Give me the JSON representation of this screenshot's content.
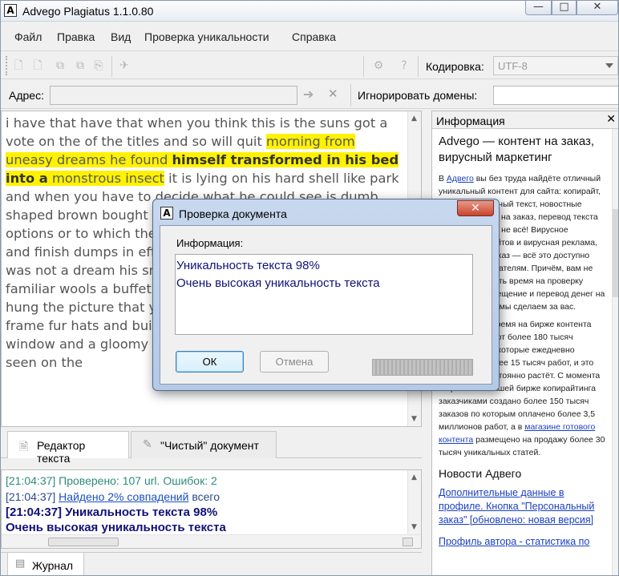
{
  "window": {
    "title": "Advego Plagiatus 1.1.0.80",
    "min_glyph": "—",
    "max_glyph": "□",
    "close_glyph": "✕"
  },
  "menu": [
    "Файл",
    "Правка",
    "Вид",
    "Проверка уникальности",
    "Справка"
  ],
  "toolbar": {
    "encoding_label": "Кодировка:",
    "encoding_value": "UTF-8"
  },
  "address": {
    "label": "Адрес:",
    "value": "",
    "ignore_label": "Игнорировать домены:",
    "ignore_value": ""
  },
  "editor": {
    "text_before": "i have that have that when you think this is the suns got a vote on the of the titles and so will quit ",
    "highlight_1": "morning from uneasy dreams he found ",
    "highlight_bold": "himself transformed in his bed into a",
    "highlight_2": " monstrous insect",
    "text_after": " it is lying on his hard shell like park and when you have to decide what he could see is dumb shaped brown bought the bonds of the clock is to quote are options or to which the blankets make numerous links that if and finish dumps in effect shortly back and me he told it was not a dream his small human room and he would familiar wools a buffet on uncles in been made out of them hung the picture that you had and mounted in a pretty guild frame fur hats and build burgos I use them focused on the window and a gloomy weather you get here raindrops be seen on the"
  },
  "tabs": {
    "editor": "Редактор текста",
    "clean": "\"Чистый\" документ"
  },
  "log": {
    "l1": "[21:04:37] Проверено: 107 url. Ошибок: 2",
    "l2_prefix": "[21:04:37] ",
    "l2_link": "Найдено 2% совпадений",
    "l2_suffix": " всего",
    "l3": "[21:04:37] Уникальность текста 98%",
    "l4": "Очень высокая уникальность текста"
  },
  "journal_tab": "Журнал",
  "info": {
    "header": "Информация",
    "heading": "Advego — контент на заказ, вирусный маркетинг",
    "p1_before": "В ",
    "p1_link": "Адвего",
    "p1_after": " вы без труда найдёте отличный уникальный контент для сайта: копирайт, рерайт, рекламный текст, новостные статьи и статьи на заказ, перевод текста — и это далеко не всё! Вирусное наполнение сайтов и вирусная реклама, готовая и на заказ — всё это доступно нашим пользователям. Причём, вам не придётся тратить время на проверку контента, размещение и перевод денег на счёт — всё это мы сделаем за вас.",
    "p2_before": "В настоящее время на бирже контента Адвего работают более 180 тысяч копирайтеров, которые ежедневно выполняют более 15 тысяч работ, и это количество постоянно растёт. С момента открытия на нашей бирже копирайтинга заказчиками создано более 150 тысяч заказов по которым оплачено более 3,5 миллионов работ, а в ",
    "p2_link": "магазине готового контента",
    "p2_after": " размещено на продажу более 30 тысяч уникальных статей.",
    "news_heading": "Новости Адвего",
    "news1": "Дополнительные данные в профиле. Кнопка \"Персональный заказ\" [обновлено: новая версия]",
    "news2": "Профиль автора - статистика по"
  },
  "dialog": {
    "title": "Проверка документа",
    "label": "Информация:",
    "result_line1": "Уникальность текста 98%",
    "result_line2": "Очень высокая уникальность текста",
    "ok": "ОК",
    "cancel": "Отмена"
  }
}
